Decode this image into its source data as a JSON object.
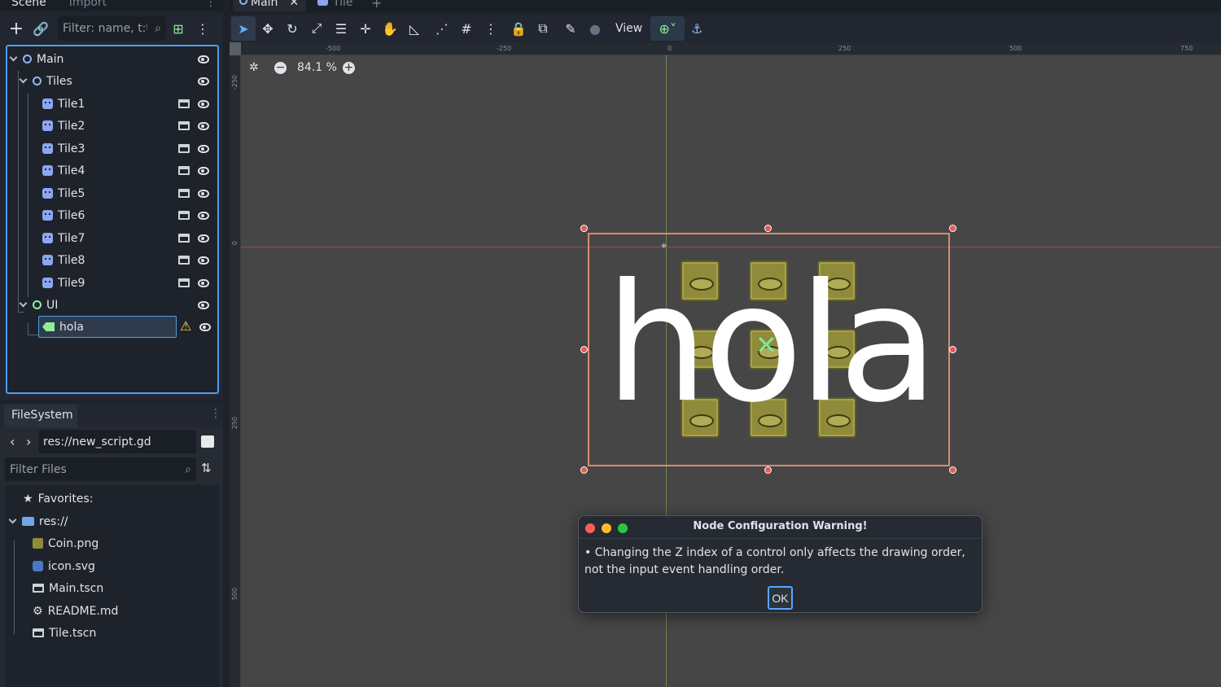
{
  "scene_dock": {
    "tabs": [
      "Scene",
      "Import"
    ],
    "filter_placeholder": "Filter: name, t:t",
    "nodes": [
      {
        "label": "Main",
        "icon": "node-ring-icon"
      },
      {
        "label": "Tiles",
        "icon": "node-ring-icon"
      },
      {
        "label": "Tile1",
        "icon": "sprite-icon"
      },
      {
        "label": "Tile2",
        "icon": "sprite-icon"
      },
      {
        "label": "Tile3",
        "icon": "sprite-icon"
      },
      {
        "label": "Tile4",
        "icon": "sprite-icon"
      },
      {
        "label": "Tile5",
        "icon": "sprite-icon"
      },
      {
        "label": "Tile6",
        "icon": "sprite-icon"
      },
      {
        "label": "Tile7",
        "icon": "sprite-icon"
      },
      {
        "label": "Tile8",
        "icon": "sprite-icon"
      },
      {
        "label": "Tile9",
        "icon": "sprite-icon"
      },
      {
        "label": "UI",
        "icon": "control-ring-icon"
      },
      {
        "label": "hola",
        "icon": "label-icon"
      }
    ]
  },
  "filesystem": {
    "tab": "FileSystem",
    "path": "res://new_script.gd",
    "filter_placeholder": "Filter Files",
    "favorites": "Favorites:",
    "root": "res://",
    "files": [
      "Coin.png",
      "icon.svg",
      "Main.tscn",
      "README.md",
      "Tile.tscn"
    ]
  },
  "editor": {
    "scene_tabs": [
      "Main",
      "Tile"
    ],
    "view_menu": "View",
    "zoom": "84.1 %",
    "ruler_h": [
      "-500",
      "-250",
      "0",
      "250",
      "500",
      "750"
    ],
    "ruler_v": [
      "-250",
      "0",
      "250",
      "500"
    ],
    "canvas_text": "hola"
  },
  "dialog": {
    "title": "Node Configuration Warning!",
    "message": "• Changing the Z index of a control only affects the drawing order, not the input event handling order.",
    "ok": "OK"
  },
  "colors": {
    "accent": "#4f9fe9",
    "warning": "#ffd84a",
    "selection": "#e08060"
  }
}
